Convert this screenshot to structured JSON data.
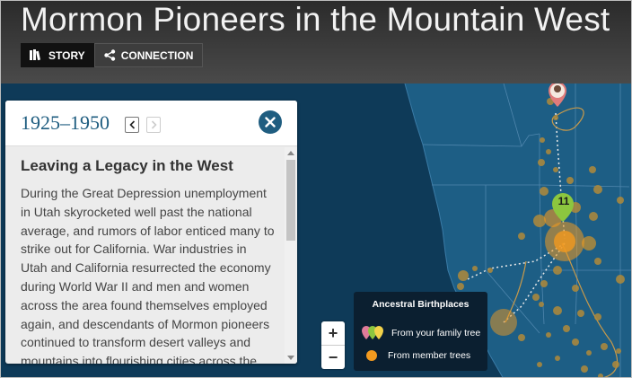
{
  "header": {
    "title": "Mormon Pioneers in the Mountain West",
    "tabs": [
      {
        "label": "STORY",
        "active": true,
        "icon": "book-icon"
      },
      {
        "label": "CONNECTION",
        "active": false,
        "icon": "share-icon"
      }
    ]
  },
  "panel": {
    "period": "1925–1950",
    "story_title": "Leaving a Legacy in the West",
    "story_text": "During the Great Depression unemployment in Utah skyrocketed well past the national average, and rumors of labor enticed many to strike out for California. War industries in Utah and California resurrected the economy during World War II and men and women across the area found themselves employed again, and descendants of Mormon pioneers continued to transform desert valleys and mountains into flourishing cities across the"
  },
  "map": {
    "marker_count": "11",
    "zoom_in_label": "+",
    "zoom_out_label": "−"
  },
  "legend": {
    "title": "Ancestral Birthplaces",
    "family_tree": "From your family tree",
    "member_trees": "From member trees"
  },
  "colors": {
    "ocean": "#0e3a58",
    "land": "#1d5e85",
    "dot": "#b08a3a",
    "accent": "#1f5d80",
    "marker_green": "#8cc63f"
  }
}
